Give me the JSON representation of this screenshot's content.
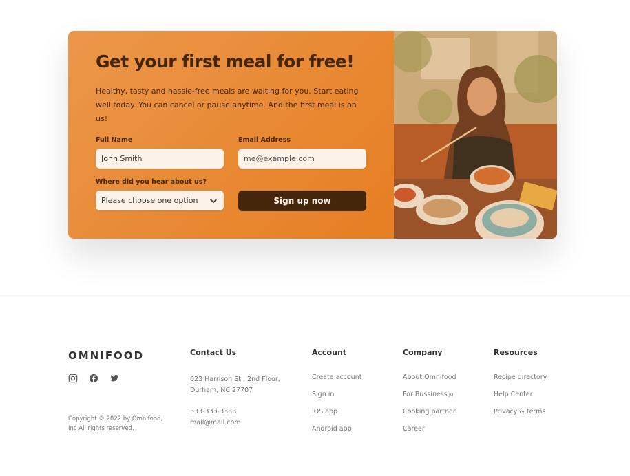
{
  "cta": {
    "title": "Get your first meal for free!",
    "text": "Healthy, tasty and hassle-free meals are waiting for you. Start eating well today. You can cancel or pause anytime. And the first meal is on us!",
    "full_name_label": "Full Name",
    "full_name_value": "John Smith",
    "email_label": "Email Address",
    "email_placeholder": "me@example.com",
    "source_label": "Where did you hear about us?",
    "source_selected": "Please choose one option",
    "submit_label": "Sign up now"
  },
  "footer": {
    "logo": "OMNIFOOD",
    "copyright": "Copyright © 2022 by Omnifood, Inc All rights reserved.",
    "contact": {
      "title": "Contact Us",
      "address_line1": "623 Harrison St., 2nd Floor,",
      "address_line2": "Durham, NC 27707",
      "phone": "333-333-3333",
      "email": "mail@mail.com"
    },
    "account": {
      "title": "Account",
      "items": [
        "Create account",
        "Sign in",
        "iOS app",
        "Android app"
      ]
    },
    "company": {
      "title": "Company",
      "items": [
        "About Omnifood",
        "For Bussiness",
        "Cooking partner",
        "Career"
      ],
      "beta": "(β)"
    },
    "resources": {
      "title": "Resources",
      "items": [
        "Recipe directory",
        "Help Center",
        "Privacy & terms"
      ]
    },
    "socials": [
      "instagram-icon",
      "facebook-icon",
      "twitter-icon"
    ]
  },
  "colors": {
    "primary": "#e67e22",
    "dark": "#45260a",
    "tint": "#fdf2e9"
  }
}
